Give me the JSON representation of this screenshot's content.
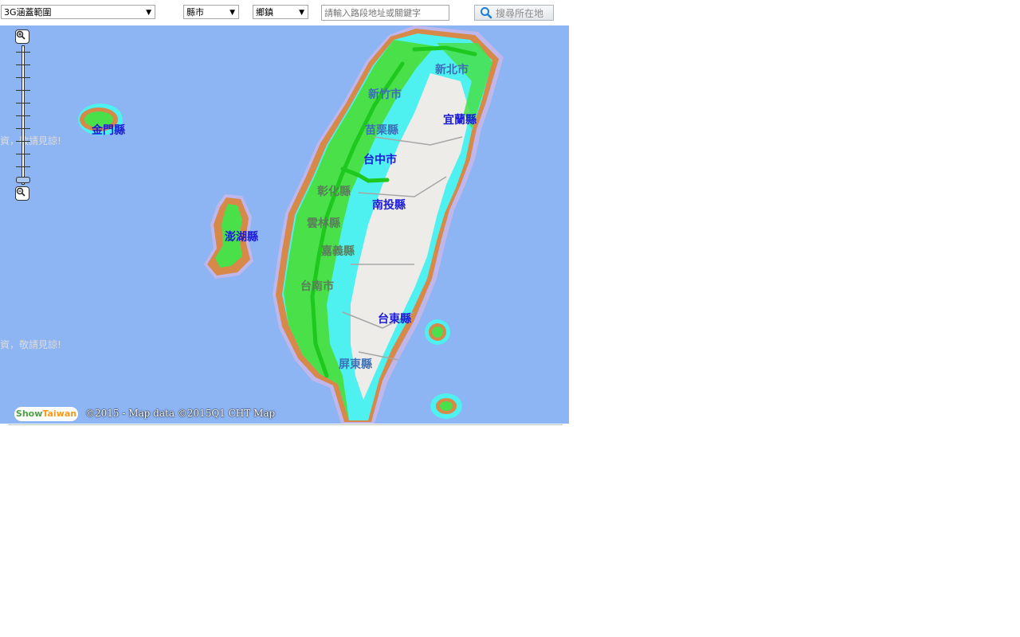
{
  "toolbar": {
    "coverage_select": "3G涵蓋範圍",
    "county_select": "縣市",
    "township_select": "鄉鎮",
    "search_placeholder": "請輸入路段地址或關鍵字",
    "search_button": "搜尋所在地"
  },
  "map": {
    "labels": {
      "xinbei": "新北市",
      "hsinchu": "新竹市",
      "yilan": "宜蘭縣",
      "miaoli": "苗栗縣",
      "taichung": "台中市",
      "changhua": "彰化縣",
      "nantou": "南投縣",
      "yunlin": "雲林縣",
      "chiayi": "嘉義縣",
      "tainan": "台南市",
      "taitung": "台東縣",
      "pingtung": "屏東縣",
      "kinmen": "金門縣",
      "penghu": "澎湖縣"
    },
    "watermark_1": "資，敬請見諒!",
    "watermark_2": "資，敬請見諒!",
    "credit": "©2015 - Map data ©2015Q1 CHT Map",
    "logo_part1": "Show",
    "logo_part2": "Taiwan"
  },
  "colors": {
    "sea": "#8db4f3",
    "coverage_strong": "#49e04a",
    "coverage_edge": "#d7894a",
    "coverage_weak": "#4ef0f0",
    "land": "#eeece8"
  }
}
